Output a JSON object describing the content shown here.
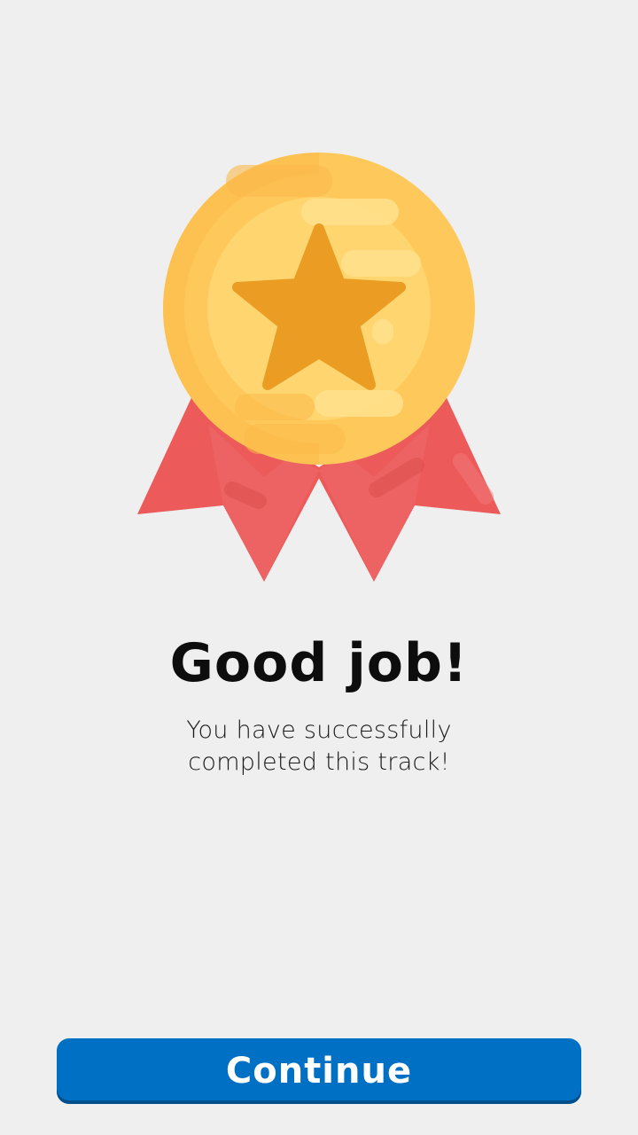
{
  "completion": {
    "title": "Good job!",
    "message_line1": "You have successfully",
    "message_line2": "completed this track!"
  },
  "actions": {
    "continue_label": "Continue"
  },
  "colors": {
    "background": "#f0efef",
    "primary_button": "#0070c4",
    "medal_gold": "#fec95a",
    "medal_star": "#eb9c23",
    "ribbon_red": "#ec5a5a"
  },
  "icons": {
    "medal": "medal-icon",
    "star": "star-icon",
    "ribbon": "ribbon-icon"
  }
}
